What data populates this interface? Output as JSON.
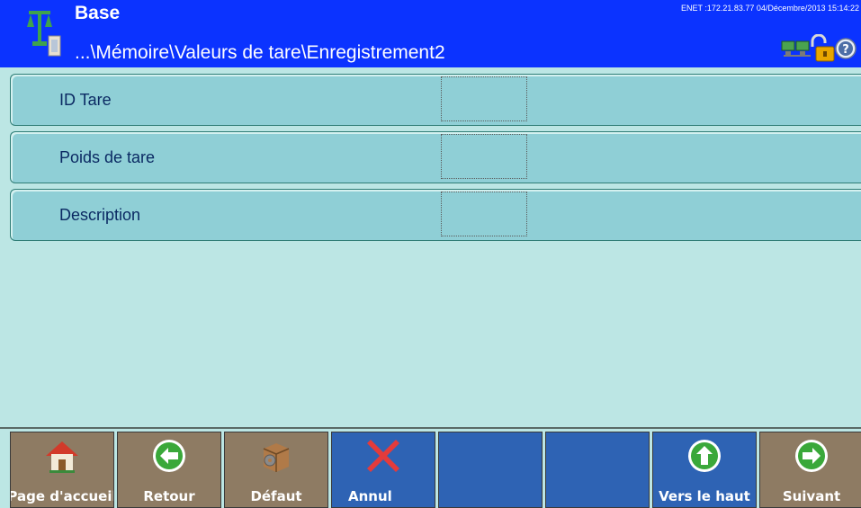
{
  "header": {
    "title": "Base",
    "path": "...\\Mémoire\\Valeurs de tare\\Enregistrement2",
    "status_line": "ENET :172.21.83.77  04/Décembre/2013 15:14:22",
    "icons": [
      "scale-icon",
      "network-icon",
      "padlock-icon",
      "help-icon"
    ]
  },
  "fields": [
    {
      "label": "ID Tare",
      "value": ""
    },
    {
      "label": "Poids de tare",
      "value": ""
    },
    {
      "label": "Description",
      "value": ""
    }
  ],
  "softkeys": [
    {
      "label": "Page d'accueil",
      "icon": "home-icon"
    },
    {
      "label": "Retour",
      "icon": "arrow-left-icon"
    },
    {
      "label": "Défaut",
      "icon": "reset-box-icon"
    },
    {
      "label": "Annul",
      "icon": "cancel-x-icon"
    },
    {
      "label": "",
      "icon": ""
    },
    {
      "label": "",
      "icon": ""
    },
    {
      "label": "Vers le haut",
      "icon": "arrow-up-icon"
    },
    {
      "label": "Suivant",
      "icon": "arrow-right-icon"
    }
  ],
  "colors": {
    "header": "#0b33ff",
    "background": "#bce6e4",
    "row": "#8fcfd6",
    "softkey_brown": "#8e7b63",
    "softkey_blue": "#2e63b4"
  }
}
